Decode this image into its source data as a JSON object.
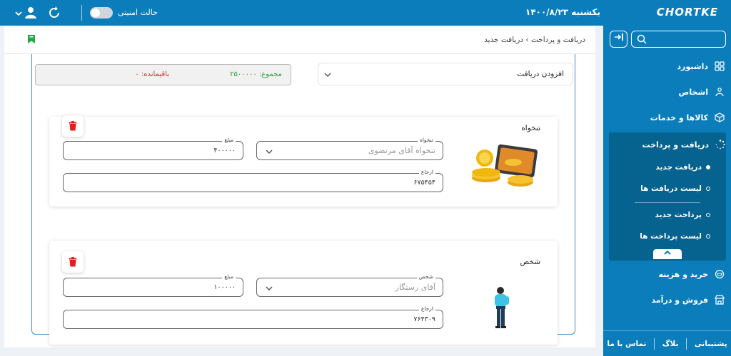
{
  "header": {
    "logo": "CHORTKE",
    "date": "یکشنبه ۱۴۰۰/۸/۲۳",
    "safe_mode_label": "حالت امنیتی"
  },
  "sidebar": {
    "items": [
      {
        "label": "داشبورد",
        "icon": "grid-icon"
      },
      {
        "label": "اشخاص",
        "icon": "people-icon"
      },
      {
        "label": "کالاها و خدمات",
        "icon": "box-icon"
      },
      {
        "label": "دریافت و پرداخت",
        "icon": "spinner-icon"
      },
      {
        "label": "خرید و هزینه",
        "icon": "cart-icon"
      },
      {
        "label": "فروش و درآمد",
        "icon": "store-icon"
      }
    ],
    "subitems": [
      {
        "label": "دریافت جدید",
        "active": true
      },
      {
        "label": "لیست دریافت ها",
        "active": false
      },
      {
        "label": "پرداخت جدید",
        "active": false
      },
      {
        "label": "لیست پرداخت ها",
        "active": false
      }
    ],
    "footer": [
      "پشتیبانی",
      "بلاگ",
      "تماس با ما"
    ]
  },
  "breadcrumb": "دریافت و پرداخت › دریافت جدید",
  "form": {
    "add_select_label": "افزودن دریافت",
    "total": "مجموع: ۲۵۰۰۰۰۰",
    "remaining": "باقیمانده: ۰",
    "cards": [
      {
        "title": "تنخواه",
        "select_label": "تنخواه",
        "select_value": "تنخواه آقای مرتضوی",
        "amount_label": "مبلغ",
        "amount_value": "۴۰۰۰۰۰",
        "ref_label": "ارجاع",
        "ref_value": "۶۷۵۴۵۴"
      },
      {
        "title": "شخص",
        "select_label": "شخص",
        "select_value": "آقای رستگار",
        "amount_label": "مبلغ",
        "amount_value": "۱۰۰۰۰۰",
        "ref_label": "ارجاع",
        "ref_value": "۷۶۴۳۰۹"
      }
    ]
  },
  "colors": {
    "primary": "#0b7dbb",
    "submenu": "#06628f",
    "total_green": "#2e9a46",
    "remaining_red": "#d62c2c",
    "trash_red": "#e02020",
    "bookmark_green": "#1fa84a"
  }
}
